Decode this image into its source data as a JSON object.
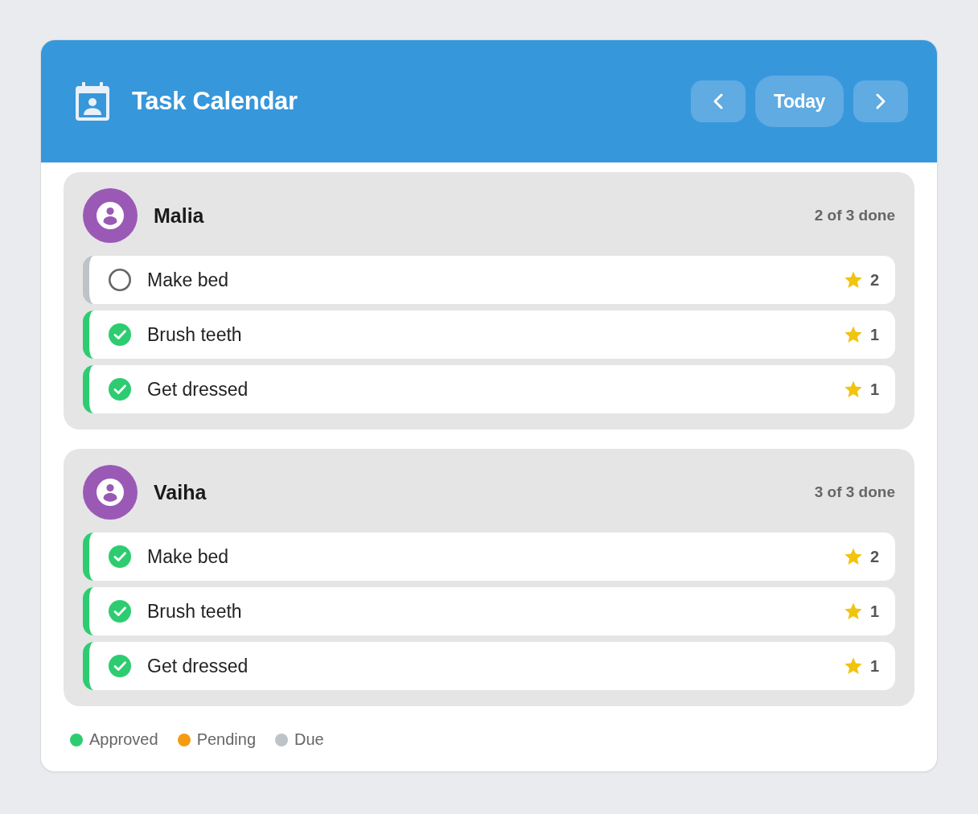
{
  "header": {
    "title": "Task Calendar",
    "buttons": [
      {
        "kind": "prev"
      },
      {
        "kind": "today",
        "label": "Today"
      },
      {
        "kind": "next"
      }
    ]
  },
  "groups": [
    {
      "name": "Malia",
      "progress": "2 of 3 done",
      "tasks": [
        {
          "title": "Make bed",
          "checked": false,
          "color": "#bdc3c7",
          "points": "2"
        },
        {
          "title": "Brush teeth",
          "checked": true,
          "color": "#2ecc71",
          "points": "1"
        },
        {
          "title": "Get dressed",
          "checked": true,
          "color": "#2ecc71",
          "points": "1"
        }
      ]
    },
    {
      "name": "Vaiha",
      "progress": "3 of 3 done",
      "tasks": [
        {
          "title": "Make bed",
          "checked": true,
          "color": "#2ecc71",
          "points": "2"
        },
        {
          "title": "Brush teeth",
          "checked": true,
          "color": "#2ecc71",
          "points": "1"
        },
        {
          "title": "Get dressed",
          "checked": true,
          "color": "#2ecc71",
          "points": "1"
        }
      ]
    }
  ],
  "legend": [
    {
      "label": "Approved",
      "color": "#2ecc71"
    },
    {
      "label": "Pending",
      "color": "#f39c12"
    },
    {
      "label": "Due",
      "color": "#bdc3c7"
    }
  ]
}
